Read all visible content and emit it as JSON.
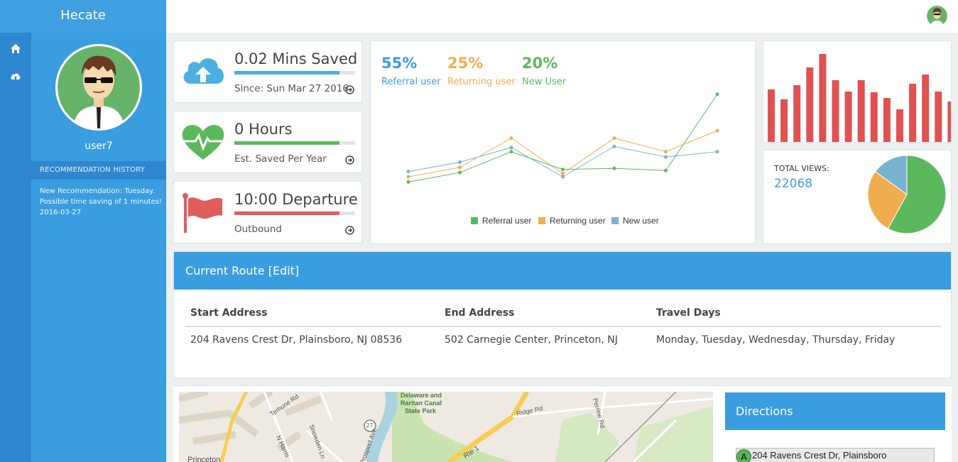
{
  "app": {
    "title": "Hecate"
  },
  "icons": {
    "nav": [
      "home-icon",
      "cloud-upload-icon"
    ],
    "user": "avatar-icon"
  },
  "sidebar": {
    "username": "user7",
    "history_header": "RECOMMENDATION HISTORY",
    "history": [
      "New Recommendation: Tuesday.",
      "Possible time saving of 1 minutes!",
      "2016-03-27"
    ]
  },
  "stats": [
    {
      "value": "0.02 Mins Saved",
      "sub": "Since: Sun Mar 27 2016",
      "icon": "cloud-upload-icon",
      "color": "#4bb0df",
      "fill": 0.87
    },
    {
      "value": "0 Hours",
      "sub": "Est. Saved Per Year",
      "icon": "heartbeat-icon",
      "color": "#5cb85c",
      "fill": 0.87
    },
    {
      "value": "10:00 Departure",
      "sub": "Outbound",
      "icon": "flag-icon",
      "color": "#e05d5d",
      "fill": 0.87
    }
  ],
  "percent_stats": [
    {
      "value": "55%",
      "label": "Referral user",
      "color": "#3a9de0"
    },
    {
      "value": "25%",
      "label": "Returning user",
      "color": "#f0ad4e"
    },
    {
      "value": "20%",
      "label": "New User",
      "color": "#5cb85c"
    }
  ],
  "colors": {
    "referral": "#5cb85c",
    "returning": "#f0ad4e",
    "new": "#7ab3d2",
    "bars": "#e05252",
    "accent": "#3a9de0"
  },
  "chart_data": [
    {
      "type": "line",
      "x": [
        1,
        2,
        3,
        4,
        5,
        6,
        7
      ],
      "series": [
        {
          "name": "Referral user",
          "values": [
            16,
            25,
            45,
            28,
            29,
            27,
            100
          ]
        },
        {
          "name": "Returning user",
          "values": [
            21,
            30,
            58,
            24,
            58,
            45,
            65
          ]
        },
        {
          "name": "New user",
          "values": [
            26,
            35,
            49,
            21,
            50,
            40,
            45
          ]
        }
      ],
      "ylim": [
        0,
        110
      ],
      "legend": "bottom"
    },
    {
      "type": "bar",
      "values": [
        74,
        60,
        80,
        105,
        124,
        87,
        71,
        87,
        70,
        62,
        46,
        82,
        95,
        71,
        57,
        40
      ],
      "ylim": [
        0,
        130
      ]
    },
    {
      "type": "pie",
      "title": "TOTAL VIEWS:",
      "total": "22068",
      "slices": [
        {
          "value": 58,
          "color": "#5cb85c"
        },
        {
          "value": 27,
          "color": "#f0ad4e"
        },
        {
          "value": 15,
          "color": "#7ab3d2"
        }
      ]
    }
  ],
  "route": {
    "title": "Current Route [Edit]",
    "columns": [
      "Start Address",
      "End Address",
      "Travel Days"
    ],
    "row": [
      "204 Ravens Crest Dr, Plainsboro, NJ 08536",
      "502 Carnegie Center, Princeton, NJ",
      "Monday, Tuesday, Wednesday, Thursday, Friday"
    ]
  },
  "map": {
    "labels": [
      "Delaware and",
      "Raritan Canal",
      "State Park",
      "Ridge Rd",
      "Terhune Rd",
      "N Harris",
      "Snowden Ln",
      "Prospect Ave",
      "Rte 1",
      "Perrine Rd",
      "27",
      "Princeton"
    ]
  },
  "directions": {
    "title": "Directions",
    "marker": "A",
    "start": "204 Ravens Crest Dr, Plainsboro"
  }
}
